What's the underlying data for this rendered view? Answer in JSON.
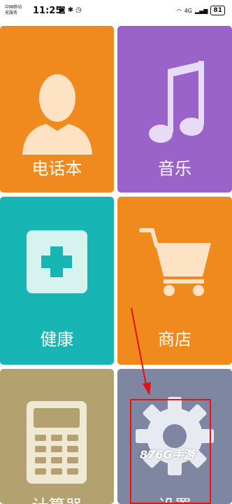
{
  "status_bar": {
    "carrier_line1": "中国移动",
    "carrier_line2": "无服务",
    "time": "11:25",
    "network": "4G",
    "battery": "81"
  },
  "tiles": [
    {
      "label": "电话本",
      "color": "#f18a1e",
      "icon": "person-silhouette-icon"
    },
    {
      "label": "音乐",
      "color": "#9a63c9",
      "icon": "music-note-icon"
    },
    {
      "label": "健康",
      "color": "#17b5b3",
      "icon": "plus-square-icon"
    },
    {
      "label": "商店",
      "color": "#f08a1c",
      "icon": "shopping-cart-icon"
    },
    {
      "label": "计算器",
      "color": "#b3a270",
      "icon": "calculator-icon"
    },
    {
      "label": "设置",
      "color": "#7e86a2",
      "icon": "gear-icon"
    }
  ],
  "watermark": "876G手游",
  "annotation_color": "#e11111"
}
